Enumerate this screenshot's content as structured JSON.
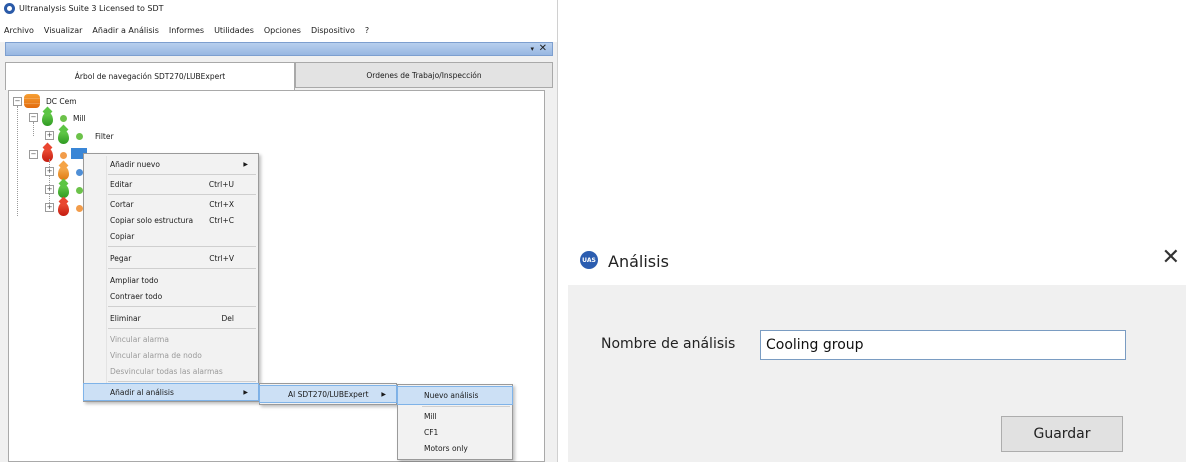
{
  "app": {
    "title": "Ultranalysis Suite 3 Licensed to SDT",
    "menu": [
      "Archivo",
      "Visualizar",
      "Añadir a Análisis",
      "Informes",
      "Utilidades",
      "Opciones",
      "Dispositivo",
      "?"
    ],
    "pane_controls": {
      "dropdown": "▾",
      "close": "✕"
    },
    "tabs": [
      "Árbol de navegación SDT270/LUBExpert",
      "Ordenes de Trabajo/Inspección"
    ],
    "tree": {
      "root": "DC Cem",
      "mill": "Mill",
      "filter": "Filter",
      "selected": ""
    },
    "context_menu": {
      "items": [
        {
          "label": "Añadir nuevo",
          "shortcut": "",
          "submenu": true,
          "disabled": false
        },
        {
          "label": "Editar",
          "shortcut": "Ctrl+U",
          "submenu": false,
          "disabled": false
        },
        {
          "label": "Cortar",
          "shortcut": "Ctrl+X",
          "submenu": false,
          "disabled": false
        },
        {
          "label": "Copiar solo estructura",
          "shortcut": "Ctrl+C",
          "submenu": false,
          "disabled": false
        },
        {
          "label": "Copiar",
          "shortcut": "",
          "submenu": false,
          "disabled": false
        },
        {
          "label": "Pegar",
          "shortcut": "Ctrl+V",
          "submenu": false,
          "disabled": false
        },
        {
          "label": "Ampliar todo",
          "shortcut": "",
          "submenu": false,
          "disabled": false
        },
        {
          "label": "Contraer todo",
          "shortcut": "",
          "submenu": false,
          "disabled": false
        },
        {
          "label": "Eliminar",
          "shortcut": "Del",
          "submenu": false,
          "disabled": false
        },
        {
          "label": "Vincular alarma",
          "shortcut": "",
          "submenu": false,
          "disabled": true
        },
        {
          "label": "Vincular alarma de nodo",
          "shortcut": "",
          "submenu": false,
          "disabled": true
        },
        {
          "label": "Desvincular todas las alarmas",
          "shortcut": "",
          "submenu": false,
          "disabled": true
        },
        {
          "label": "Añadir al análisis",
          "shortcut": "",
          "submenu": true,
          "disabled": false
        }
      ],
      "submenu_1": {
        "label": "Al SDT270/LUBExpert"
      },
      "submenu_2": {
        "items": [
          "Nuevo análisis",
          "Mill",
          "CF1",
          "Motors only"
        ]
      }
    }
  },
  "dialog": {
    "icon_text": "UAS",
    "title": "Análisis",
    "close": "✕",
    "field_label": "Nombre de análisis",
    "field_value": "Cooling group",
    "save_button": "Guardar"
  },
  "colors": {
    "selection_blue": "#3a86d6",
    "menu_highlight": "#cce0f5",
    "pane_header": "#98b7e2"
  }
}
